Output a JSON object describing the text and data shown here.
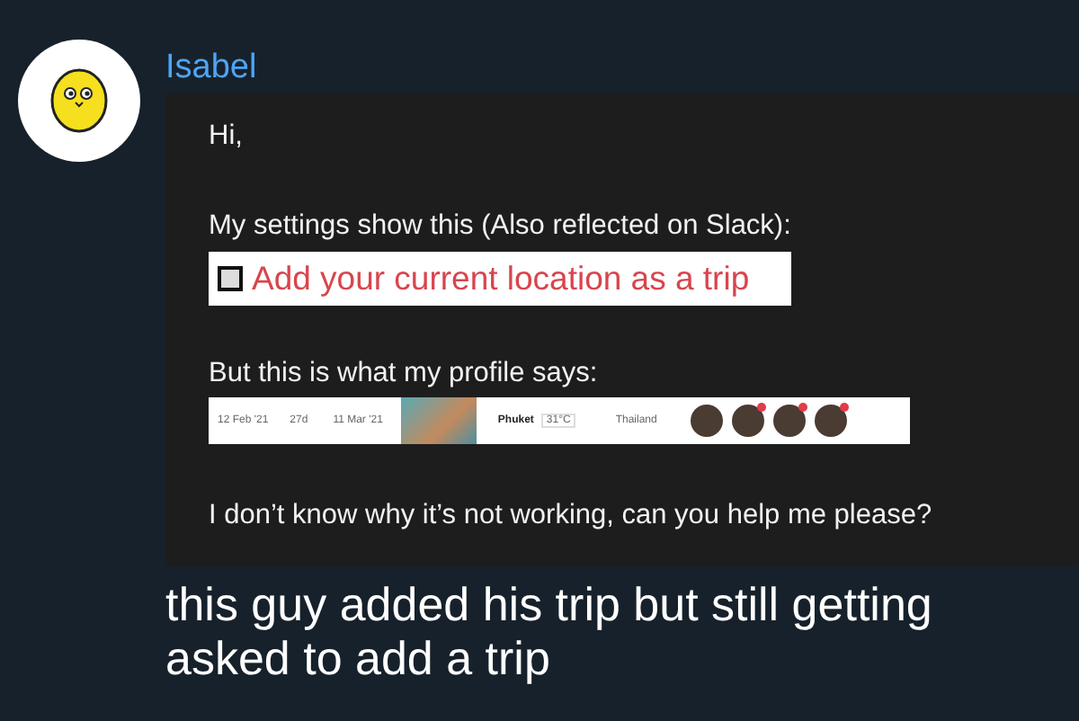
{
  "message": {
    "sender": "Isabel",
    "screenshot": {
      "greeting": "Hi,",
      "settings_text": "My settings show this (Also reflected on Slack):",
      "setting": {
        "label": "Add your current location as a trip",
        "checked": false
      },
      "profile_text": "But this is what my profile says:",
      "trip": {
        "start": "12 Feb '21",
        "duration": "27d",
        "end": "11 Mar '21",
        "city": "Phuket",
        "temperature": "31°C",
        "country": "Thailand",
        "avatars": [
          {
            "badge": false
          },
          {
            "badge": true
          },
          {
            "badge": true
          },
          {
            "badge": true
          }
        ]
      },
      "question": "I don’t know why it’s not working, can you help me please?"
    },
    "caption": "this guy added his trip but still getting asked to add a trip"
  }
}
